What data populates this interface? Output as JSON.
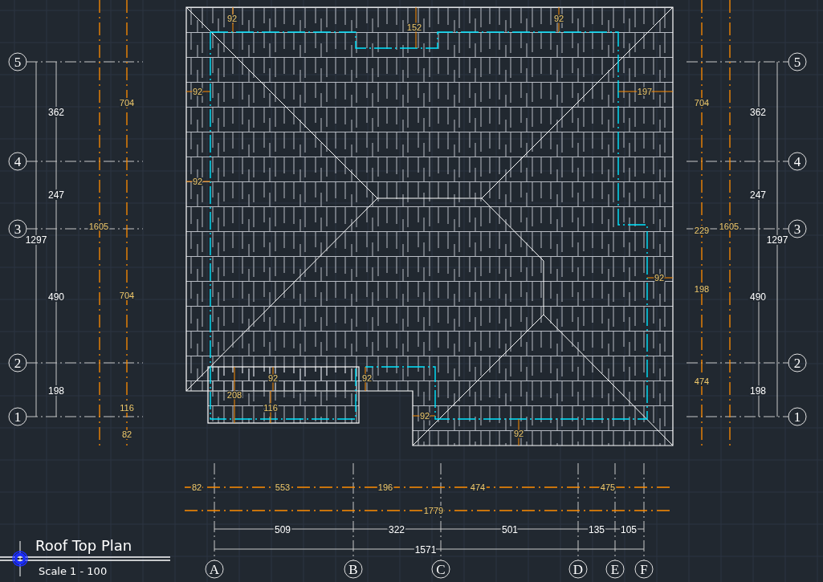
{
  "grid_left": {
    "bubbles": [
      "5",
      "4",
      "3",
      "2",
      "1"
    ],
    "segments": [
      "362",
      "247",
      "490",
      "198"
    ],
    "total": "1297"
  },
  "orange_left": {
    "total": "1605",
    "segments": [
      "704",
      "704",
      "116",
      "82"
    ]
  },
  "roof_dims": [
    "92",
    "152",
    "92",
    "92",
    "197",
    "92",
    "92",
    "92",
    "92",
    "208",
    "116",
    "92",
    "92"
  ],
  "orange_right": {
    "segments": [
      "704",
      "229",
      "198",
      "474"
    ],
    "total": "1605"
  },
  "grid_right": {
    "segments": [
      "362",
      "247",
      "490",
      "198"
    ],
    "total": "1297",
    "bubbles": [
      "5",
      "4",
      "3",
      "2",
      "1"
    ]
  },
  "orange_bottom": {
    "segments": [
      "82",
      "553",
      "196",
      "474",
      "475"
    ],
    "total": "1779"
  },
  "grid_bottom": {
    "segments": [
      "509",
      "322",
      "501",
      "135",
      "105"
    ],
    "total": "1571",
    "bubbles": [
      "A",
      "B",
      "C",
      "D",
      "E",
      "F"
    ]
  },
  "title": {
    "text": "Roof Top Plan",
    "scale": "Scale  1 - 100"
  }
}
